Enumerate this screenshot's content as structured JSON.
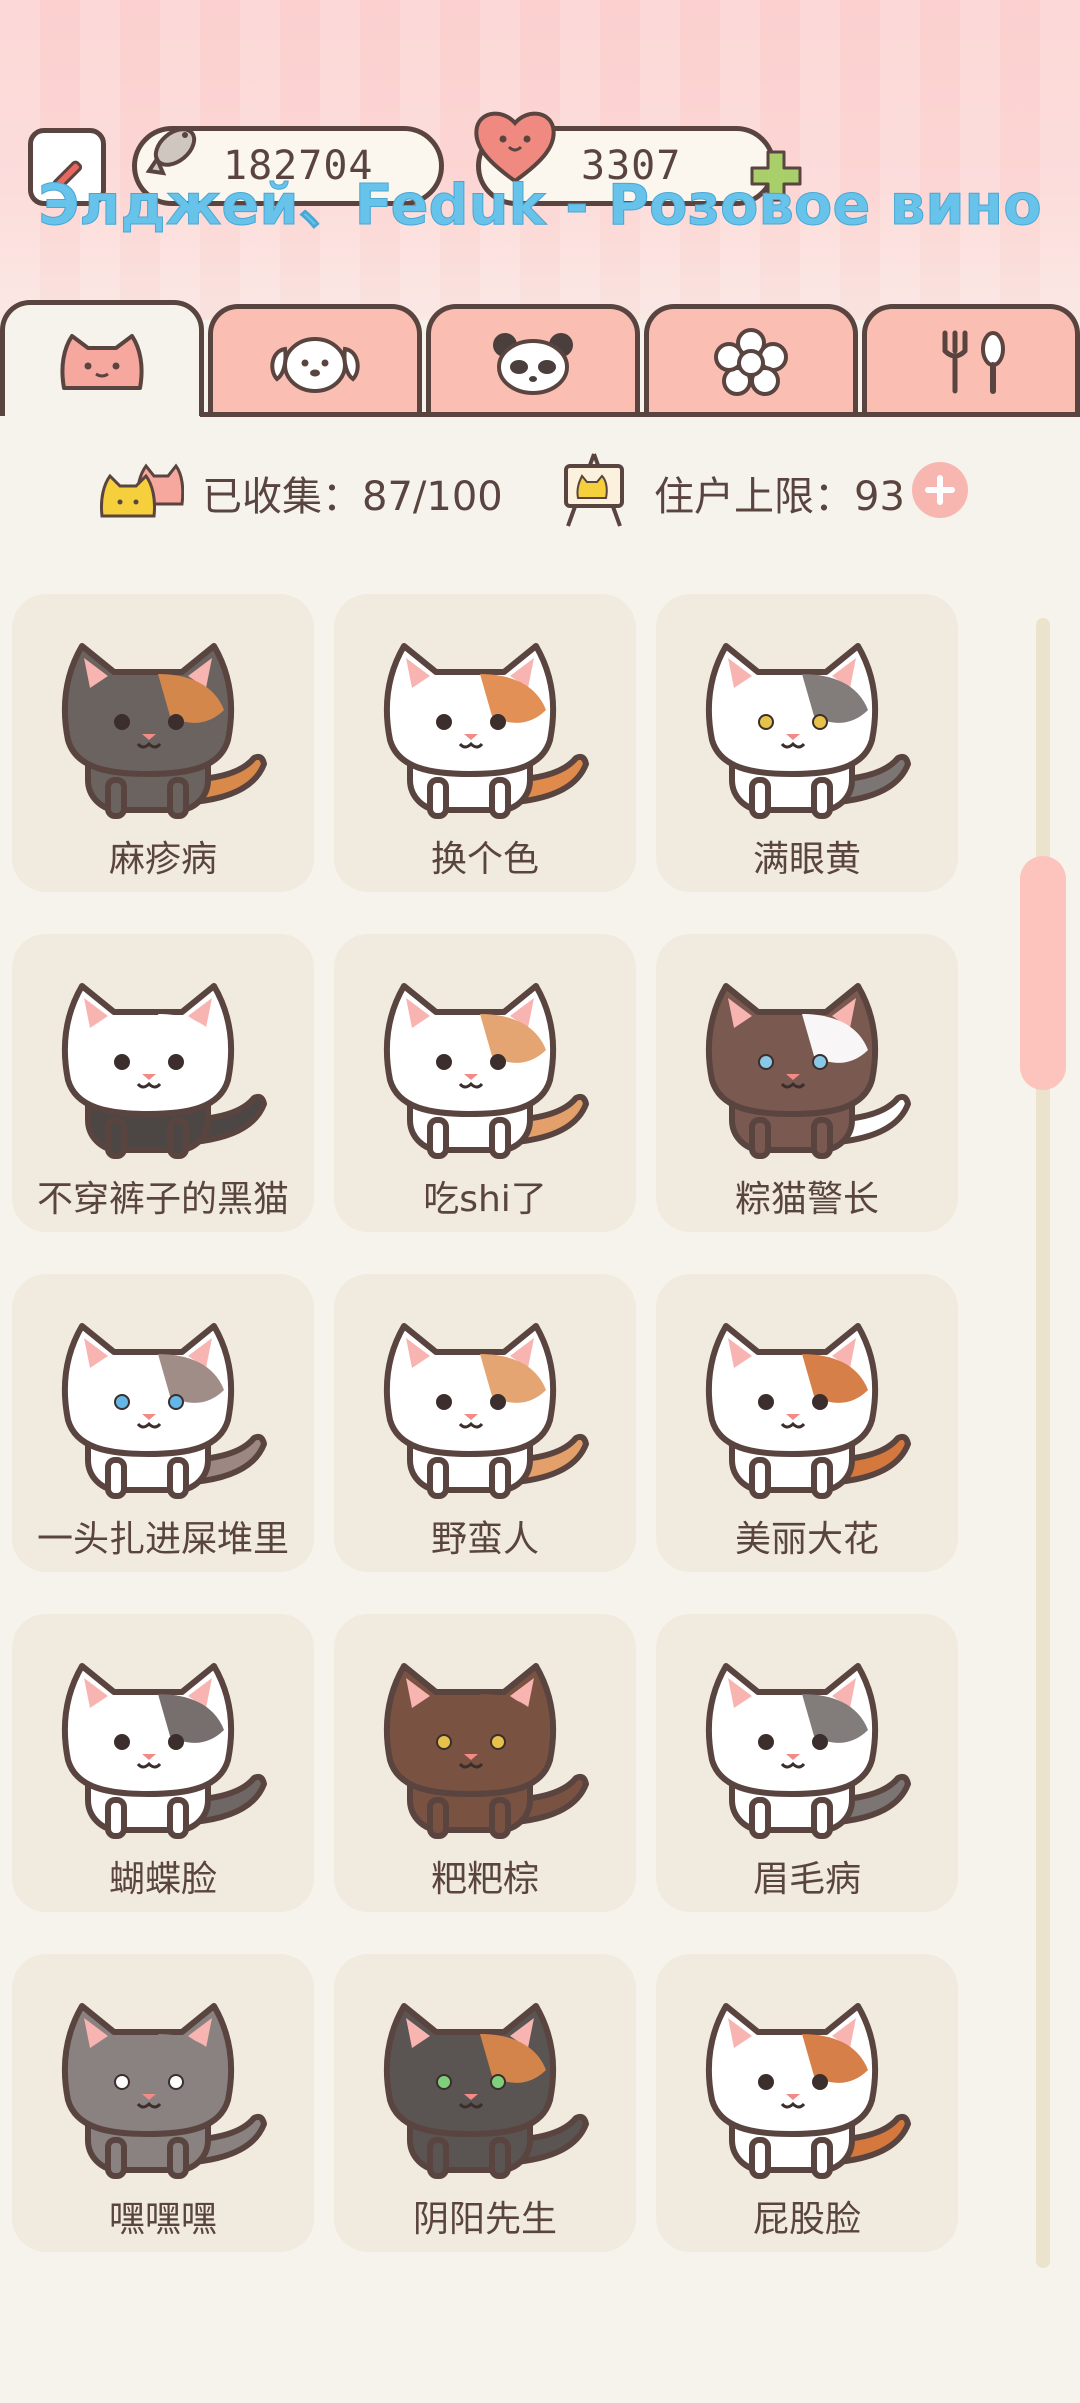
{
  "header": {
    "fish_count": "182704",
    "heart_count": "3307",
    "lyric": "Элджей、Feduk - Розовое вино",
    "lyric_dots": "......",
    "fish_icon": "fish-icon",
    "heart_icon": "heart-face-icon",
    "edit_icon": "pencil-icon",
    "plus_icon": "green-plus-icon"
  },
  "tabs": [
    {
      "icon": "cat-face-icon",
      "active": true
    },
    {
      "icon": "dog-face-icon",
      "active": false
    },
    {
      "icon": "panda-face-icon",
      "active": false
    },
    {
      "icon": "flower-icon",
      "active": false
    },
    {
      "icon": "fork-spoon-icon",
      "active": false
    }
  ],
  "stats": {
    "collected": "已收集：87/100",
    "capacity": "住户上限：93"
  },
  "cats": [
    {
      "name": "麻疹病",
      "body": "#6b6360",
      "patch": "#d9894a",
      "belly": "#6b6360",
      "ear": "#6b6360",
      "eye": "#3b2e2c",
      "tail": "#d9894a"
    },
    {
      "name": "换个色",
      "body": "#ffffff",
      "patch": "#e08a4c",
      "belly": "#ffffff",
      "ear": "#e08a4c",
      "eye": "#3b2e2c",
      "tail": "#e08a4c"
    },
    {
      "name": "满眼黄",
      "body": "#ffffff",
      "patch": "#7b7574",
      "belly": "#ffffff",
      "ear": "#7b7574",
      "eye": "#e6c24a",
      "tail": "#7b7574"
    },
    {
      "name": "不穿裤子的黑猫",
      "body": "#ffffff",
      "patch": "#ffffff",
      "belly": "#4c4644",
      "ear": "#ffffff",
      "eye": "#3b2e2c",
      "tail": "#4c4644"
    },
    {
      "name": "吃shi了",
      "body": "#ffffff",
      "patch": "#e4a06a",
      "belly": "#ffffff",
      "ear": "#ffffff",
      "eye": "#3b2e2c",
      "tail": "#e4a06a"
    },
    {
      "name": "粽猫警长",
      "body": "#7a5a50",
      "patch": "#ffffff",
      "belly": "#7a5a50",
      "ear": "#7a5a50",
      "eye": "#8ac8e8",
      "tail": "#ffffff"
    },
    {
      "name": "一头扎进屎堆里",
      "body": "#ffffff",
      "patch": "#9c8782",
      "belly": "#ffffff",
      "ear": "#ffffff",
      "eye": "#63b6e6",
      "tail": "#9c8782"
    },
    {
      "name": "野蛮人",
      "body": "#ffffff",
      "patch": "#e4a06a",
      "belly": "#ffffff",
      "ear": "#ffffff",
      "eye": "#3b2e2c",
      "tail": "#e4a06a"
    },
    {
      "name": "美丽大花",
      "body": "#ffffff",
      "patch": "#d4783e",
      "belly": "#ffffff",
      "ear": "#d4783e",
      "eye": "#3b2e2c",
      "tail": "#d4783e"
    },
    {
      "name": "蝴蝶脸",
      "body": "#ffffff",
      "patch": "#6f6766",
      "belly": "#ffffff",
      "ear": "#6f6766",
      "eye": "#3b2e2c",
      "tail": "#6f6766"
    },
    {
      "name": "粑粑棕",
      "body": "#7a5242",
      "patch": "#7a5242",
      "belly": "#7a5242",
      "ear": "#7a5242",
      "eye": "#e6c24a",
      "tail": "#7a5242"
    },
    {
      "name": "眉毛病",
      "body": "#ffffff",
      "patch": "#7b7574",
      "belly": "#ffffff",
      "ear": "#ffffff",
      "eye": "#3b2e2c",
      "tail": "#7b7574"
    },
    {
      "name": "嘿嘿嘿",
      "body": "#8a8280",
      "patch": "#8a8280",
      "belly": "#8a8280",
      "ear": "#8a8280",
      "eye": "#ffffff",
      "tail": "#8a8280"
    },
    {
      "name": "阴阳先生",
      "body": "#5a5452",
      "patch": "#d9874a",
      "belly": "#5a5452",
      "ear": "#5a5452",
      "eye": "#7fd07a",
      "tail": "#5a5452"
    },
    {
      "name": "屁股脸",
      "body": "#ffffff",
      "patch": "#d4783e",
      "belly": "#ffffff",
      "ear": "#d4783e",
      "eye": "#3b2e2c",
      "tail": "#d4783e"
    }
  ],
  "scroll": {
    "thumb_position": 0.16
  }
}
